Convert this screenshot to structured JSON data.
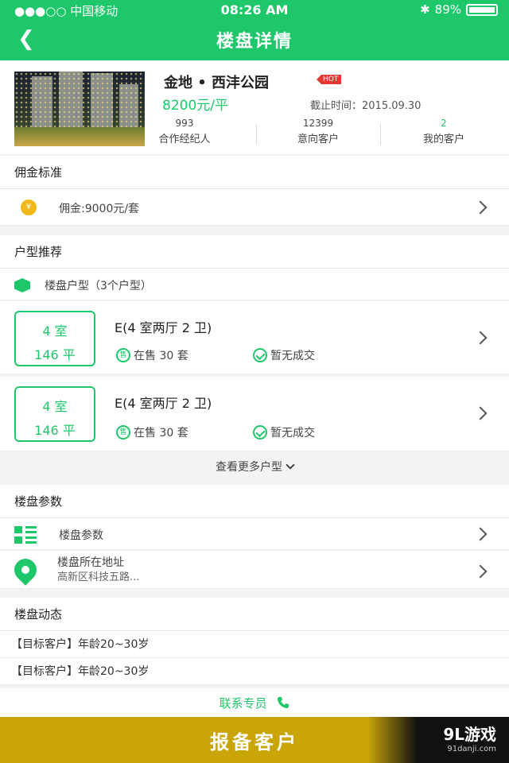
{
  "status_bar": {
    "carrier": "●●●○○ 中国移动",
    "time": "08:26 AM",
    "battery": "89%"
  },
  "nav": {
    "title": "楼盘详情"
  },
  "property": {
    "name": "金地 • 西沣公园",
    "hot_badge": "HOT",
    "price": "8200元/平",
    "deadline": "截止时间：2015.09.30",
    "stats": [
      {
        "num": "993",
        "label": "合作经纪人"
      },
      {
        "num": "12399",
        "label": "意向客户"
      },
      {
        "num": "2",
        "label": "我的客户"
      }
    ]
  },
  "commission": {
    "section_title": "佣金标准",
    "coin_icon": "¥",
    "text": "佣金:9000元/套"
  },
  "units": {
    "section_title": "户型推荐",
    "header_text": "楼盘户型（3个户型）",
    "items": [
      {
        "rooms": "4 室",
        "area": "146 平",
        "name": "E(4 室两厅 2 卫)",
        "sale_icon": "售",
        "on_sale": "在售 30 套",
        "deal": "暂无成交"
      },
      {
        "rooms": "4 室",
        "area": "146 平",
        "name": "E(4 室两厅 2 卫)",
        "sale_icon": "售",
        "on_sale": "在售 30 套",
        "deal": "暂无成交"
      }
    ],
    "more_label": "查看更多户型"
  },
  "params": {
    "section_title": "楼盘参数",
    "params_label": "楼盘参数",
    "address_label": "楼盘所在地址",
    "address_value": "高新区科技五路..."
  },
  "news": {
    "section_title": "楼盘动态",
    "items": [
      "【目标客户】年龄20~30岁",
      "【目标客户】年龄20~30岁"
    ]
  },
  "contact": {
    "label": "联系专员"
  },
  "bottom": {
    "report_label": "报备客户",
    "watermark_main": "9L游戏",
    "watermark_sub": "91danji.com"
  },
  "colors": {
    "brand_green": "#1ec86a",
    "bottom_gold": "#c9a508",
    "hot_red": "#e53935"
  }
}
